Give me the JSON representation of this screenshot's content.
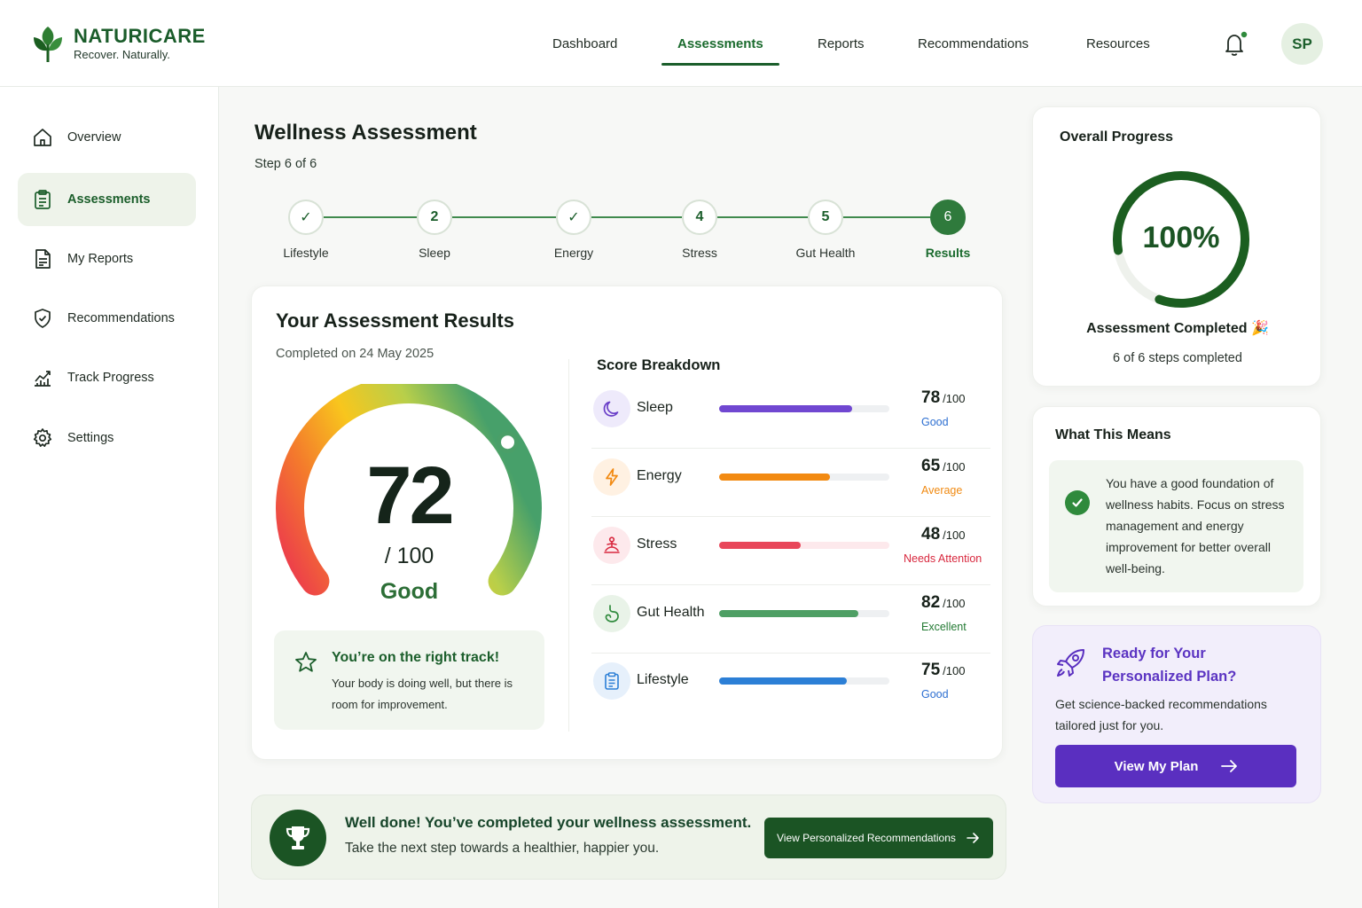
{
  "brand": {
    "name": "NATURICARE",
    "tagline": "Recover. Naturally."
  },
  "topnav": [
    {
      "label": "Dashboard",
      "active": false
    },
    {
      "label": "Assessments",
      "active": true
    },
    {
      "label": "Reports",
      "active": false
    },
    {
      "label": "Recommendations",
      "active": false
    },
    {
      "label": "Resources",
      "active": false
    }
  ],
  "user": {
    "initials": "SP",
    "notifications_dot": true
  },
  "sidebar": {
    "items": [
      {
        "label": "Overview",
        "icon": "home-icon",
        "active": false
      },
      {
        "label": "Assessments",
        "icon": "clipboard-icon",
        "active": true
      },
      {
        "label": "My Reports",
        "icon": "document-icon",
        "active": false
      },
      {
        "label": "Recommendations",
        "icon": "shield-check-icon",
        "active": false
      },
      {
        "label": "Track Progress",
        "icon": "chart-trend-icon",
        "active": false
      },
      {
        "label": "Settings",
        "icon": "gear-icon",
        "active": false
      }
    ]
  },
  "page": {
    "title": "Wellness Assessment",
    "step_text": "Step 6 of 6"
  },
  "stepper": {
    "steps": [
      {
        "label": "Lifestyle",
        "marker": "✓",
        "state": "done"
      },
      {
        "label": "Sleep",
        "marker": "2",
        "state": "done"
      },
      {
        "label": "Energy",
        "marker": "✓",
        "state": "done"
      },
      {
        "label": "Stress",
        "marker": "4",
        "state": "done"
      },
      {
        "label": "Gut Health",
        "marker": "5",
        "state": "done"
      },
      {
        "label": "Results",
        "marker": "6",
        "state": "current"
      }
    ]
  },
  "results": {
    "title": "Your Assessment Results",
    "completed": "Completed on 24 May 2025",
    "score": "72",
    "score_max": "/ 100",
    "score_label": "Good",
    "score_fraction": 0.72,
    "track_title": "You’re on the right track!",
    "track_desc": "Your body is doing well, but there is room for improvement."
  },
  "breakdown": {
    "title": "Score Breakdown",
    "items": [
      {
        "name": "Sleep",
        "score": "78",
        "of": "/100",
        "status": "Good",
        "value": 78,
        "color": "#7047d1",
        "status_color": "#2d6fd1",
        "icon": "moon-icon",
        "icon_bg": "#eeeafb"
      },
      {
        "name": "Energy",
        "score": "65",
        "of": "/100",
        "status": "Average",
        "value": 65,
        "color": "#f28a12",
        "status_color": "#f08a12",
        "icon": "lightning-icon",
        "icon_bg": "#fff1e2"
      },
      {
        "name": "Stress",
        "score": "48",
        "of": "/100",
        "status": "Needs Attention",
        "value": 48,
        "color": "#e8475a",
        "status_color": "#d8283e",
        "icon": "meditation-icon",
        "icon_bg": "#fde9ec"
      },
      {
        "name": "Gut Health",
        "score": "82",
        "of": "/100",
        "status": "Excellent",
        "value": 82,
        "color": "#4e9f64",
        "status_color": "#237a33",
        "icon": "stomach-icon",
        "icon_bg": "#e9f3e8"
      },
      {
        "name": "Lifestyle",
        "score": "75",
        "of": "/100",
        "status": "Good",
        "value": 75,
        "color": "#2c7fd6",
        "status_color": "#2d6fd1",
        "icon": "clipboard-list-icon",
        "icon_bg": "#e6f0fb"
      }
    ]
  },
  "banner": {
    "title": "Well done! You’ve completed your wellness assessment.",
    "subtitle": "Take the next step towards a healthier, happier you.",
    "button": "View Personalized Recommendations"
  },
  "progress": {
    "title": "Overall Progress",
    "percent_label": "100%",
    "fraction": 1.0,
    "completed_label": "Assessment Completed 🎉",
    "steps_label": "6 of 6 steps completed"
  },
  "means": {
    "title": "What This Means",
    "text": "You have a good foundation of wellness habits. Focus on stress management and energy improvement for better overall well-being."
  },
  "plan": {
    "title": "Ready for Your Personalized Plan?",
    "desc": "Get science-backed recommendations tailored just for you.",
    "button": "View My Plan"
  }
}
